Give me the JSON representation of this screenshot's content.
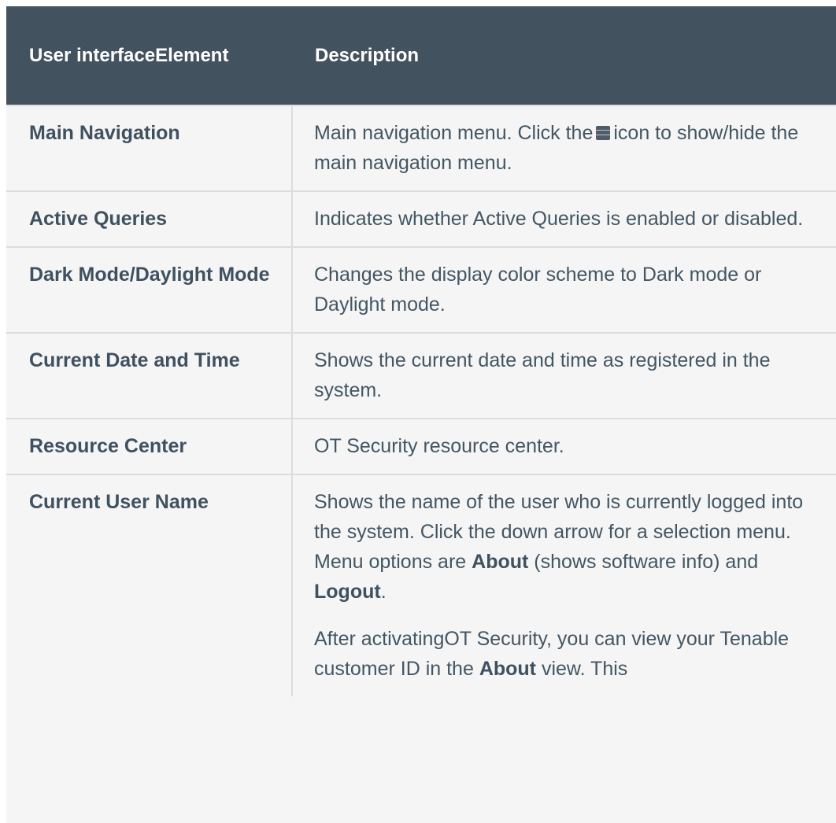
{
  "table": {
    "headers": {
      "element": "User interfaceElement",
      "description": "Description"
    },
    "rows": [
      {
        "element": "Main Navigation",
        "description_before_icon": "Main navigation menu. Click the",
        "icon": "menu-icon",
        "description_after_icon": "icon to show/hide the main navigation menu."
      },
      {
        "element": "Active Queries",
        "description": "Indicates whether Active Queries is enabled or disabled."
      },
      {
        "element": "Dark Mode/Daylight Mode",
        "description": "Changes the display color scheme to Dark mode or Daylight mode."
      },
      {
        "element": "Current Date and Time",
        "description": "Shows the current date and time as registered in the system."
      },
      {
        "element": "Resource Center",
        "description": "OT Security resource center."
      },
      {
        "element": "Current User Name",
        "p1_text": "Shows the name of the user who is currently logged into the system. Click the down arrow for a selection menu. Menu options are",
        "p1_bold_about": "About",
        "p1_mid": "(shows software info) and",
        "p1_bold_logout": "Logout",
        "p1_end": ".",
        "p2_text": "After activatingOT Security, you can view your Tenable customer ID in the",
        "p2_bold_about": "About",
        "p2_end": "view. This"
      }
    ]
  },
  "colors": {
    "header_bg": "#43525f",
    "row_bg": "#f5f5f5",
    "text": "#435663"
  }
}
